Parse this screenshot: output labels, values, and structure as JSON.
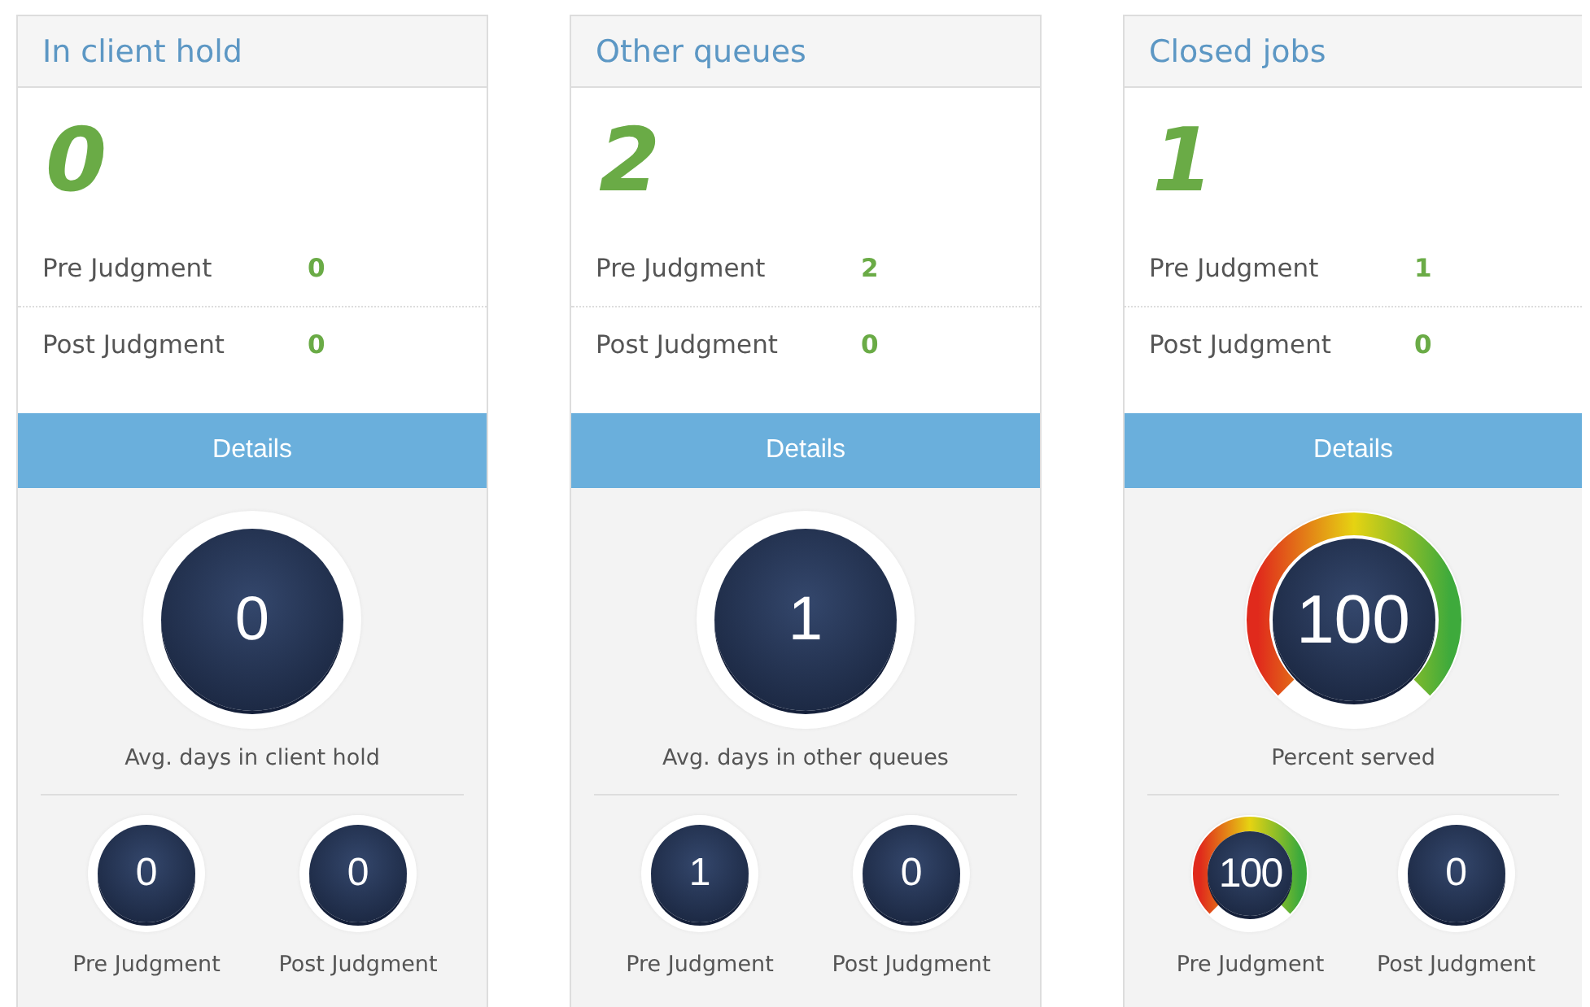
{
  "panels": [
    {
      "title": "In client hold",
      "total": "0",
      "rows": [
        {
          "label": "Pre Judgment",
          "value": "0"
        },
        {
          "label": "Post Judgment",
          "value": "0"
        }
      ],
      "button": "Details",
      "main_dial": {
        "kind": "dial",
        "value": "0",
        "caption": "Avg. days in client hold"
      },
      "sub_dials": [
        {
          "kind": "dial",
          "value": "0",
          "caption": "Pre Judgment"
        },
        {
          "kind": "dial",
          "value": "0",
          "caption": "Post Judgment"
        }
      ]
    },
    {
      "title": "Other queues",
      "total": "2",
      "rows": [
        {
          "label": "Pre Judgment",
          "value": "2"
        },
        {
          "label": "Post Judgment",
          "value": "0"
        }
      ],
      "button": "Details",
      "main_dial": {
        "kind": "dial",
        "value": "1",
        "caption": "Avg. days in other queues"
      },
      "sub_dials": [
        {
          "kind": "dial",
          "value": "1",
          "caption": "Pre Judgment"
        },
        {
          "kind": "dial",
          "value": "0",
          "caption": "Post Judgment"
        }
      ]
    },
    {
      "title": "Closed jobs",
      "total": "1",
      "rows": [
        {
          "label": "Pre Judgment",
          "value": "1"
        },
        {
          "label": "Post Judgment",
          "value": "0"
        }
      ],
      "button": "Details",
      "main_dial": {
        "kind": "gauge",
        "value": "100",
        "caption": "Percent served"
      },
      "sub_dials": [
        {
          "kind": "gauge",
          "value": "100",
          "caption": "Pre Judgment"
        },
        {
          "kind": "dial",
          "value": "0",
          "caption": "Post Judgment"
        }
      ]
    }
  ]
}
